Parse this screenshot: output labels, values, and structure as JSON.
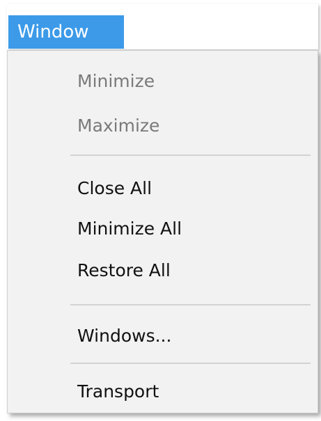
{
  "menubar": {
    "active_menu": "Window",
    "accent_color": "#3c9ae8"
  },
  "menu": {
    "items": [
      {
        "label": "Minimize",
        "enabled": false
      },
      {
        "label": "Maximize",
        "enabled": false
      },
      {
        "label": "Close All",
        "enabled": true
      },
      {
        "label": "Minimize All",
        "enabled": true
      },
      {
        "label": "Restore All",
        "enabled": true
      },
      {
        "label": "Windows...",
        "enabled": true
      },
      {
        "label": "Transport",
        "enabled": true
      }
    ]
  }
}
